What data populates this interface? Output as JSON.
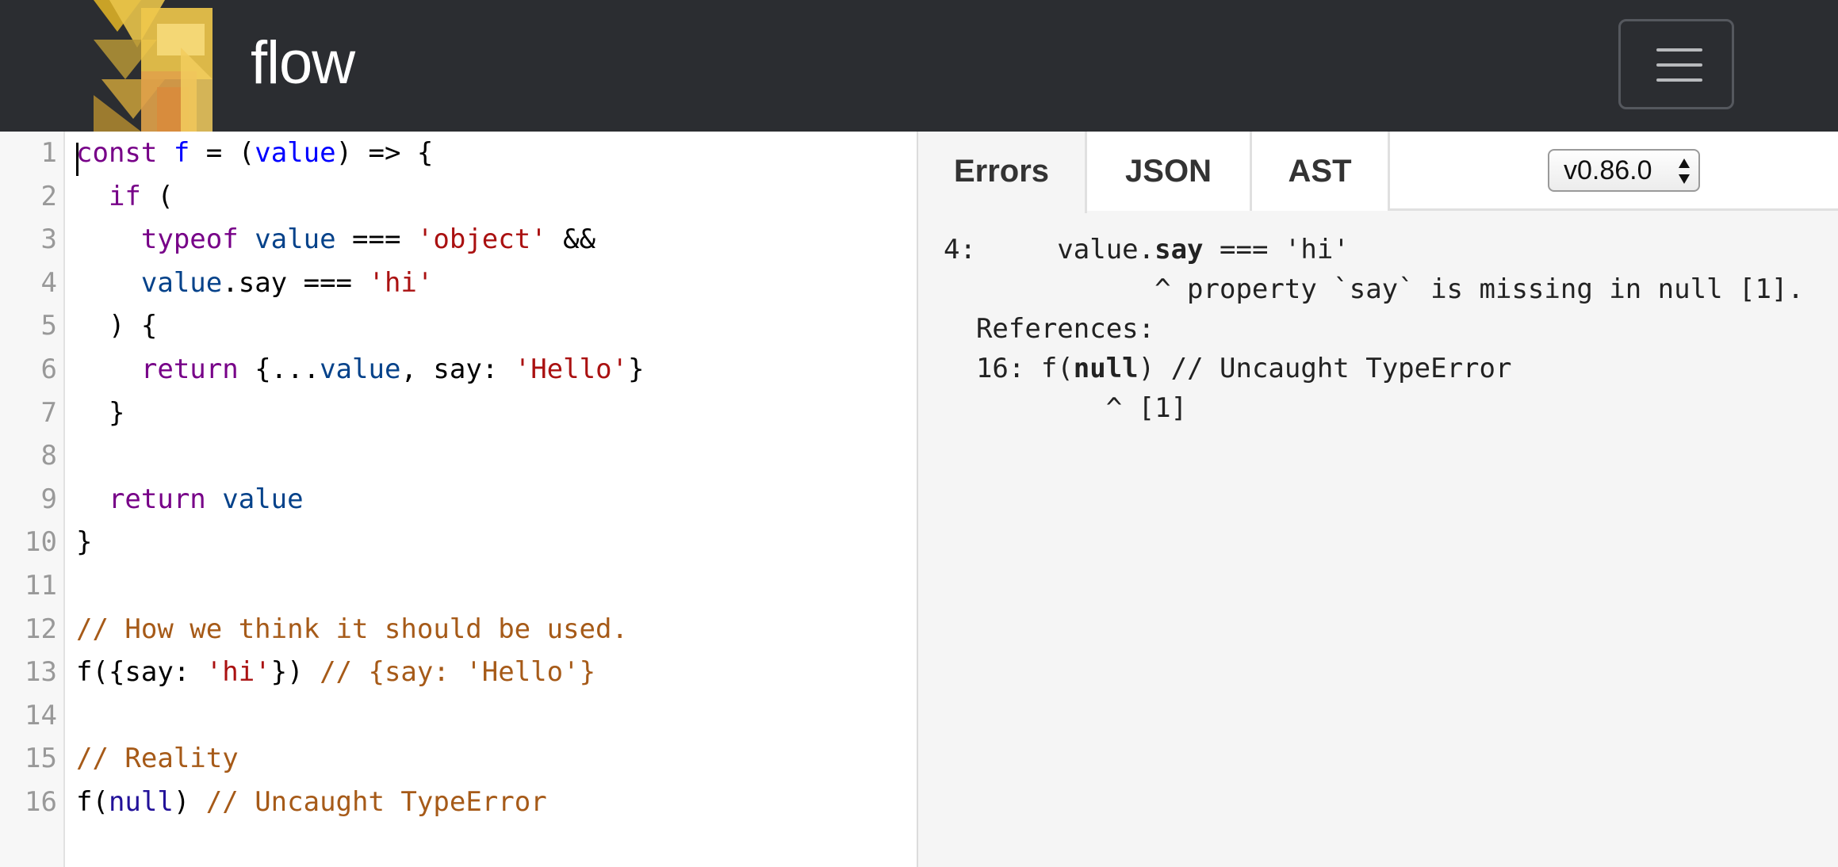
{
  "header": {
    "brand": "flow",
    "menu_icon": "hamburger-icon"
  },
  "editor": {
    "lines": [
      {
        "n": "1",
        "tokens": [
          {
            "t": "const",
            "c": "kw"
          },
          {
            "t": " ",
            "c": "pn"
          },
          {
            "t": "f",
            "c": "def"
          },
          {
            "t": " = (",
            "c": "pn"
          },
          {
            "t": "value",
            "c": "def"
          },
          {
            "t": ") => {",
            "c": "pn"
          }
        ]
      },
      {
        "n": "2",
        "tokens": [
          {
            "t": "  ",
            "c": "pn"
          },
          {
            "t": "if",
            "c": "kw"
          },
          {
            "t": " (",
            "c": "pn"
          }
        ]
      },
      {
        "n": "3",
        "tokens": [
          {
            "t": "    ",
            "c": "pn"
          },
          {
            "t": "typeof",
            "c": "kw"
          },
          {
            "t": " ",
            "c": "pn"
          },
          {
            "t": "value",
            "c": "var"
          },
          {
            "t": " === ",
            "c": "pn"
          },
          {
            "t": "'object'",
            "c": "str"
          },
          {
            "t": " &&",
            "c": "pn"
          }
        ]
      },
      {
        "n": "4",
        "tokens": [
          {
            "t": "    ",
            "c": "pn"
          },
          {
            "t": "value",
            "c": "var"
          },
          {
            "t": ".say === ",
            "c": "pn"
          },
          {
            "t": "'hi'",
            "c": "str"
          }
        ]
      },
      {
        "n": "5",
        "tokens": [
          {
            "t": "  ) {",
            "c": "pn"
          }
        ]
      },
      {
        "n": "6",
        "tokens": [
          {
            "t": "    ",
            "c": "pn"
          },
          {
            "t": "return",
            "c": "kw"
          },
          {
            "t": " {...",
            "c": "pn"
          },
          {
            "t": "value",
            "c": "var"
          },
          {
            "t": ", say: ",
            "c": "pn"
          },
          {
            "t": "'Hello'",
            "c": "str"
          },
          {
            "t": "}",
            "c": "pn"
          }
        ]
      },
      {
        "n": "7",
        "tokens": [
          {
            "t": "  }",
            "c": "pn"
          }
        ]
      },
      {
        "n": "8",
        "tokens": []
      },
      {
        "n": "9",
        "tokens": [
          {
            "t": "  ",
            "c": "pn"
          },
          {
            "t": "return",
            "c": "kw"
          },
          {
            "t": " ",
            "c": "pn"
          },
          {
            "t": "value",
            "c": "var"
          }
        ]
      },
      {
        "n": "10",
        "tokens": [
          {
            "t": "}",
            "c": "pn"
          }
        ]
      },
      {
        "n": "11",
        "tokens": []
      },
      {
        "n": "12",
        "tokens": [
          {
            "t": "// How we think it should be used.",
            "c": "com"
          }
        ]
      },
      {
        "n": "13",
        "tokens": [
          {
            "t": "f({say: ",
            "c": "pn"
          },
          {
            "t": "'hi'",
            "c": "str"
          },
          {
            "t": "}) ",
            "c": "pn"
          },
          {
            "t": "// {say: 'Hello'}",
            "c": "com"
          }
        ]
      },
      {
        "n": "14",
        "tokens": []
      },
      {
        "n": "15",
        "tokens": [
          {
            "t": "// Reality",
            "c": "com"
          }
        ]
      },
      {
        "n": "16",
        "tokens": [
          {
            "t": "f(",
            "c": "pn"
          },
          {
            "t": "null",
            "c": "atom"
          },
          {
            "t": ") ",
            "c": "pn"
          },
          {
            "t": "// Uncaught TypeError",
            "c": "com"
          }
        ]
      }
    ]
  },
  "panel": {
    "tabs": [
      "Errors",
      "JSON",
      "AST"
    ],
    "active_tab": "Errors",
    "version": "v0.86.0",
    "errors": [
      {
        "segments": [
          {
            "t": "4:     value.",
            "b": false
          },
          {
            "t": "say",
            "b": true
          },
          {
            "t": " === 'hi'",
            "b": false
          }
        ]
      },
      {
        "segments": [
          {
            "t": "             ^ property `say` is missing in null [1].",
            "b": false
          }
        ]
      },
      {
        "segments": [
          {
            "t": "  References:",
            "b": false
          }
        ]
      },
      {
        "segments": [
          {
            "t": "  16: f(",
            "b": false
          },
          {
            "t": "null",
            "b": true
          },
          {
            "t": ") // Uncaught TypeError",
            "b": false
          }
        ]
      },
      {
        "segments": [
          {
            "t": "          ^ [1]",
            "b": false
          }
        ]
      }
    ]
  },
  "colors": {
    "topbar_bg": "#2b2d31",
    "keyword": "#770088",
    "variable": "#05428a",
    "string": "#aa1111",
    "comment": "#a65a18"
  }
}
